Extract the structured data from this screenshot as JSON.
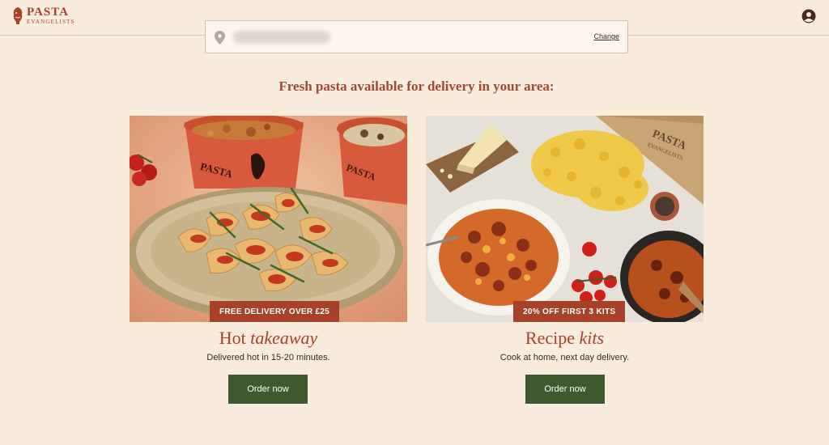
{
  "brand": {
    "name": "PASTA",
    "sub": "EVANGELISTS"
  },
  "address": {
    "value": "●●●●●●●●●●●●●●●●",
    "change_label": "Change"
  },
  "headline": "Fresh pasta available for delivery in your area:",
  "cards": [
    {
      "badge": "FREE DELIVERY OVER £25",
      "title_main": "Hot ",
      "title_italic": "takeaway",
      "description": "Delivered hot in 15-20 minutes.",
      "button": "Order now",
      "cup_brand": "PASTA"
    },
    {
      "badge": "20% OFF FIRST 3 KITS",
      "title_main": "Recipe ",
      "title_italic": "kits",
      "description": "Cook at home, next day delivery.",
      "button": "Order now",
      "box_brand": "PASTA",
      "box_sub": "EVANGELISTS"
    }
  ],
  "icons": {
    "logo": "lion-crest-icon",
    "account": "user-circle-icon",
    "pin": "location-pin-icon"
  },
  "colors": {
    "background": "#f9ecdc",
    "accent": "#a8412a",
    "button": "#3f5a31"
  }
}
